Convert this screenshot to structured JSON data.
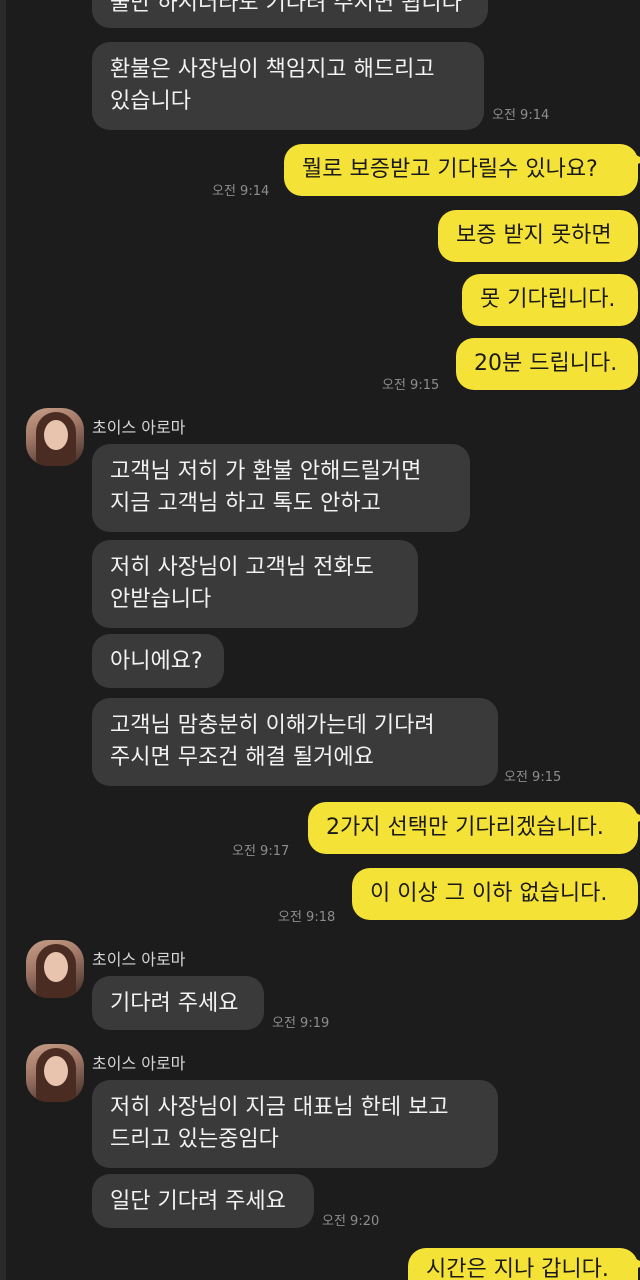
{
  "chat": {
    "contact_name": "초이스 아로마",
    "messages": [
      {
        "text": "불만 하시더라도 기다려 주시면 됩니다"
      },
      {
        "text": "환불은 사장님이 책임지고 해드리고\n있습니다",
        "time": "오전 9:14"
      },
      {
        "text": "뭘로 보증받고 기다릴수 있나요?",
        "time": "오전 9:14"
      },
      {
        "text": "보증 받지 못하면"
      },
      {
        "text": "못 기다립니다."
      },
      {
        "text": "20분 드립니다.",
        "time": "오전 9:15"
      },
      {
        "text": "고객님 저히 가 환불 안해드릴거면\n지금 고객님 하고 톡도 안하고"
      },
      {
        "text": "저히 사장님이 고객님 전화도\n안받습니다"
      },
      {
        "text": "아니에요?"
      },
      {
        "text": "고객님 맘충분히 이해가는데 기다려\n주시면 무조건 해결 될거에요",
        "time": "오전 9:15"
      },
      {
        "text": "2가지 선택만 기다리겠습니다.",
        "time": "오전 9:17"
      },
      {
        "text": "이 이상 그 이하 없습니다.",
        "time": "오전 9:18"
      },
      {
        "text": "기다려 주세요",
        "time": "오전 9:19"
      },
      {
        "text": "저히 사장님이 지금 대표님 한테 보고\n드리고 있는중임다"
      },
      {
        "text": "일단 기다려 주세요",
        "time": "오전 9:20"
      },
      {
        "text": "시간은 지나 갑니다."
      }
    ]
  },
  "colors": {
    "background": "#1c1c1c",
    "incoming_bubble": "#3a3a3a",
    "outgoing_bubble": "#f5e237"
  }
}
